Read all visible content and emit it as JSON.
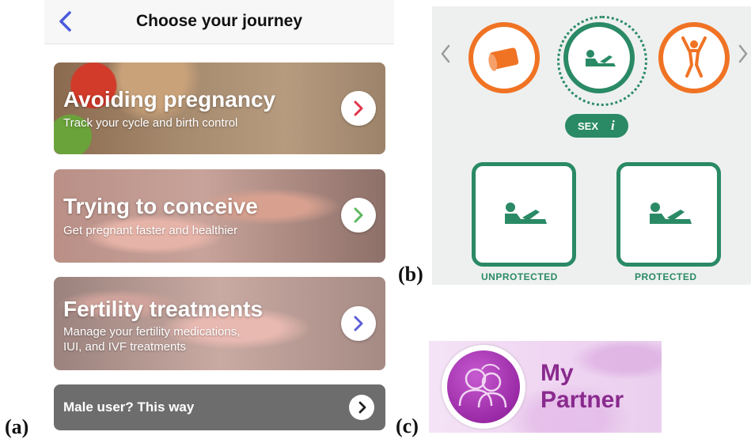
{
  "panel_a": {
    "header_title": "Choose your journey",
    "cards": [
      {
        "title": "Avoiding pregnancy",
        "subtitle": "Track your cycle and birth control",
        "arrow_color": "#e0344b"
      },
      {
        "title": "Trying to conceive",
        "subtitle": "Get pregnant faster and healthier",
        "arrow_color": "#5cb85c"
      },
      {
        "title": "Fertility treatments",
        "subtitle": "Manage your fertility medications,\nIUI, and IVF treatments",
        "arrow_color": "#5b5fd6"
      }
    ],
    "male_link": "Male user? This way",
    "label": "(a)",
    "icons": [
      "back-chevron-icon",
      "chevron-right-icon"
    ]
  },
  "panel_b": {
    "label": "(b)",
    "category_pill": "SEX",
    "info_icon": "i",
    "options": [
      "UNPROTECTED",
      "PROTECTED"
    ],
    "colors": {
      "orange": "#f07324",
      "green": "#2a8a66"
    },
    "icons": [
      "bandage-icon",
      "reclining-figure-icon",
      "arms-raised-figure-icon"
    ]
  },
  "panel_c": {
    "label": "(c)",
    "title_line1": "My",
    "title_line2": "Partner",
    "icons": [
      "couple-icon"
    ]
  }
}
